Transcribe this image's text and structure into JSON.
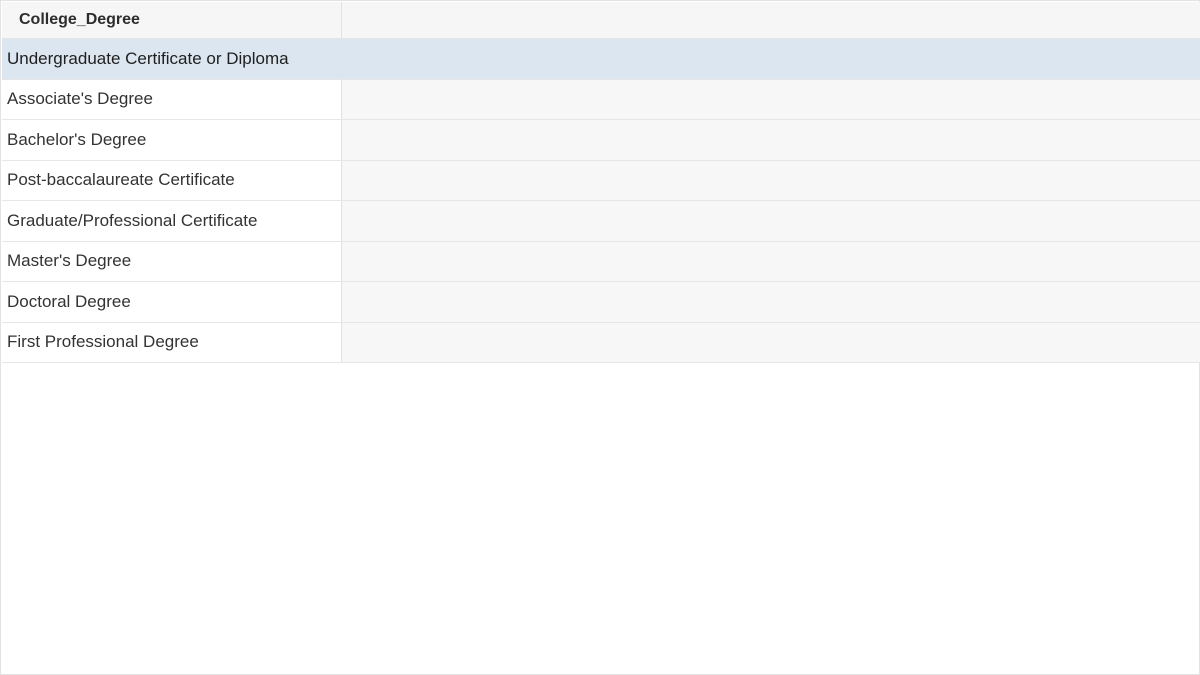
{
  "table": {
    "column_header": "College_Degree",
    "rows": [
      {
        "label": "Undergraduate Certificate or Diploma",
        "selected": true
      },
      {
        "label": "Associate's Degree",
        "selected": false
      },
      {
        "label": "Bachelor's Degree",
        "selected": false
      },
      {
        "label": "Post-baccalaureate Certificate",
        "selected": false
      },
      {
        "label": "Graduate/Professional Certificate",
        "selected": false
      },
      {
        "label": "Master's Degree",
        "selected": false
      },
      {
        "label": "Doctoral Degree",
        "selected": false
      },
      {
        "label": "First Professional Degree",
        "selected": false
      }
    ]
  },
  "colors": {
    "selected_row": "#dbe6f0",
    "row_fill": "#f7f7f7",
    "header_fill": "#f6f6f6"
  }
}
